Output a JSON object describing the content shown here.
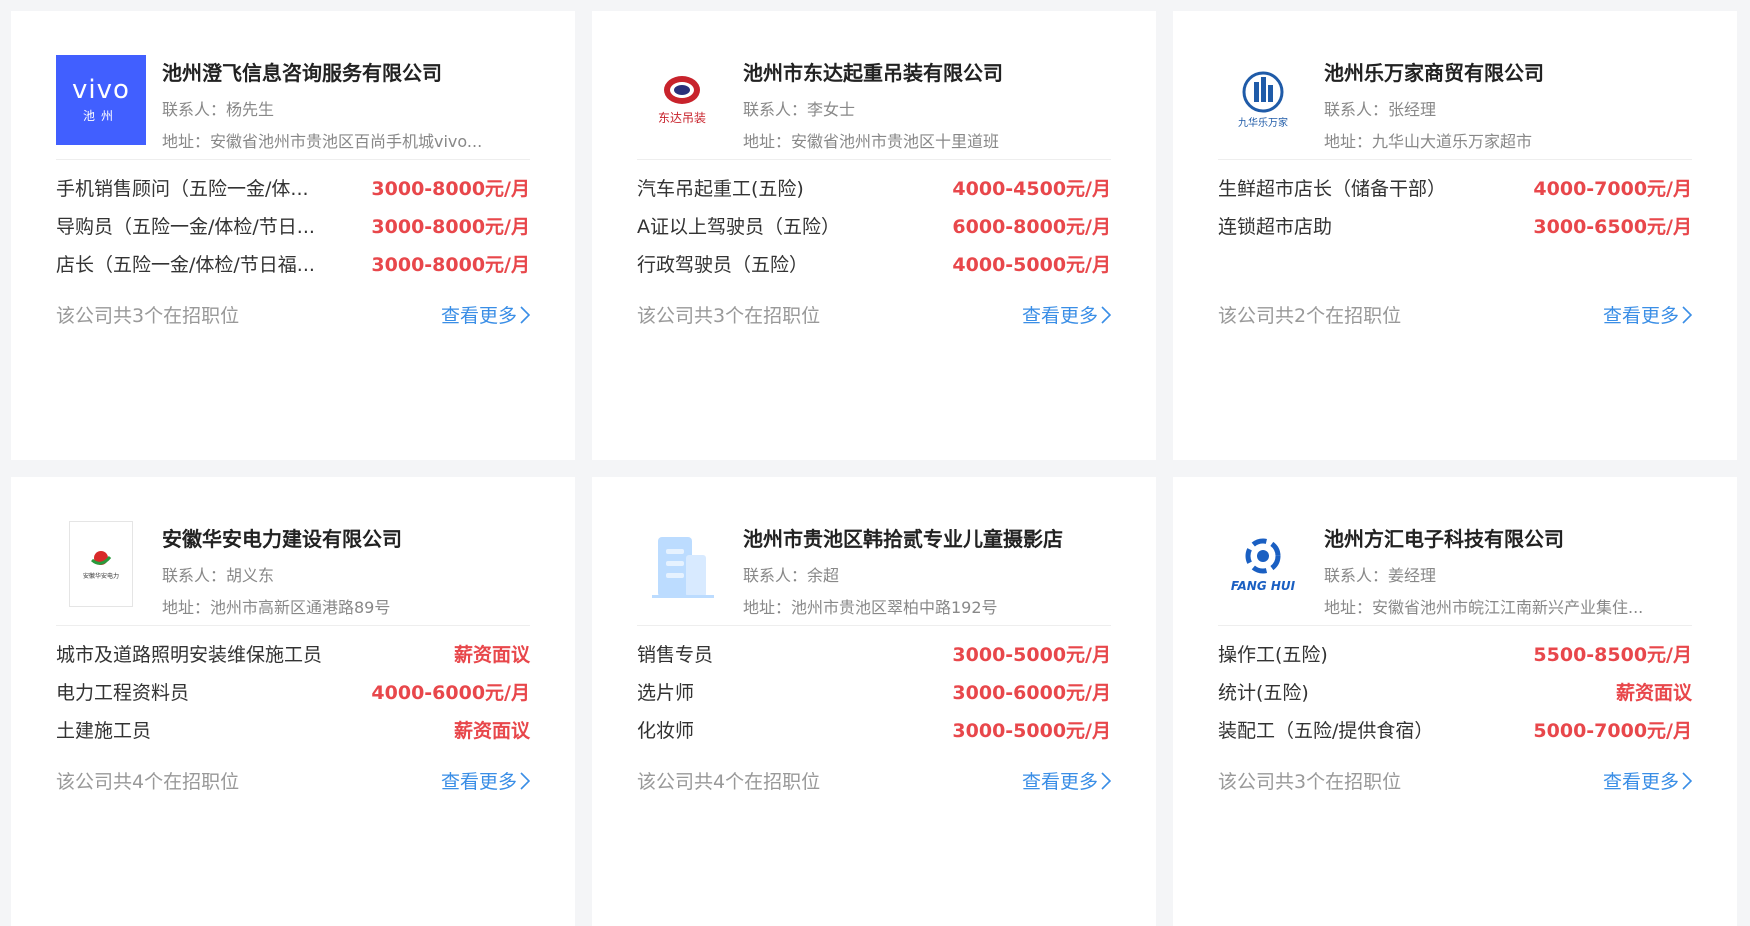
{
  "colors": {
    "salary": "#e8474b",
    "link": "#3a8ee6",
    "vivo_blue": "#415fff"
  },
  "cards": [
    {
      "logo_icon": "vivo-logo",
      "logo_text_1": "vivo",
      "logo_text_2": "池州",
      "name": "池州澄飞信息咨询服务有限公司",
      "contact": "联系人：杨先生",
      "address": "地址：安徽省池州市贵池区百尚手机城vivo...",
      "jobs": [
        {
          "title": "手机销售顾问（五险一金/体...",
          "salary": "3000-8000元/月"
        },
        {
          "title": "导购员（五险一金/体检/节日...",
          "salary": "3000-8000元/月"
        },
        {
          "title": "店长（五险一金/体检/节日福...",
          "salary": "3000-8000元/月"
        }
      ],
      "count": "该公司共3个在招职位",
      "more": "查看更多"
    },
    {
      "logo_icon": "dongda-logo",
      "logo_text": "东达吊装",
      "name": "池州市东达起重吊装有限公司",
      "contact": "联系人：李女士",
      "address": "地址：安徽省池州市贵池区十里道班",
      "jobs": [
        {
          "title": "汽车吊起重工(五险)",
          "salary": "4000-4500元/月"
        },
        {
          "title": "A证以上驾驶员（五险）",
          "salary": "6000-8000元/月"
        },
        {
          "title": "行政驾驶员（五险）",
          "salary": "4000-5000元/月"
        }
      ],
      "count": "该公司共3个在招职位",
      "more": "查看更多"
    },
    {
      "logo_icon": "jiuhua-logo",
      "logo_text": "九华乐万家",
      "name": "池州乐万家商贸有限公司",
      "contact": "联系人：张经理",
      "address": "地址：九华山大道乐万家超市",
      "jobs": [
        {
          "title": "生鲜超市店长（储备干部）",
          "salary": "4000-7000元/月"
        },
        {
          "title": "连锁超市店助",
          "salary": "3000-6500元/月"
        }
      ],
      "count": "该公司共2个在招职位",
      "more": "查看更多"
    },
    {
      "logo_icon": "huaan-logo",
      "logo_text": "安徽华安电力",
      "name": "安徽华安电力建设有限公司",
      "contact": "联系人：胡义东",
      "address": "地址：池州市高新区通港路89号",
      "jobs": [
        {
          "title": "城市及道路照明安装维保施工员",
          "salary": "薪资面议"
        },
        {
          "title": "电力工程资料员",
          "salary": "4000-6000元/月"
        },
        {
          "title": "土建施工员",
          "salary": "薪资面议"
        }
      ],
      "count": "该公司共4个在招职位",
      "more": "查看更多"
    },
    {
      "logo_icon": "building-icon",
      "name": "池州市贵池区韩拾贰专业儿童摄影店",
      "contact": "联系人：余超",
      "address": "地址：池州市贵池区翠柏中路192号",
      "jobs": [
        {
          "title": "销售专员",
          "salary": "3000-5000元/月"
        },
        {
          "title": "选片师",
          "salary": "3000-6000元/月"
        },
        {
          "title": "化妆师",
          "salary": "3000-5000元/月"
        }
      ],
      "count": "该公司共4个在招职位",
      "more": "查看更多"
    },
    {
      "logo_icon": "fanghui-logo",
      "logo_text": "FANG HUI",
      "name": "池州方汇电子科技有限公司",
      "contact": "联系人：姜经理",
      "address": "地址：安徽省池州市皖江江南新兴产业集住...",
      "jobs": [
        {
          "title": "操作工(五险)",
          "salary": "5500-8500元/月"
        },
        {
          "title": "统计(五险)",
          "salary": "薪资面议"
        },
        {
          "title": "装配工（五险/提供食宿）",
          "salary": "5000-7000元/月"
        }
      ],
      "count": "该公司共3个在招职位",
      "more": "查看更多"
    }
  ]
}
